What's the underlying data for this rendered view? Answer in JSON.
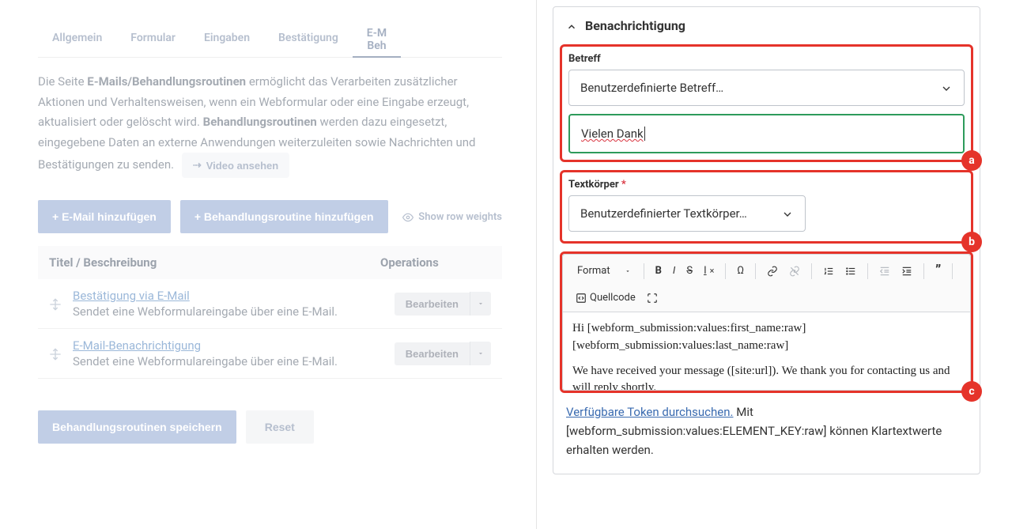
{
  "tabs": [
    "Allgemein",
    "Formular",
    "Eingaben",
    "Bestätigung",
    "E-M\nBeh"
  ],
  "intro": {
    "pre": "Die Seite ",
    "strong1": "E-Mails/Behandlungsroutinen",
    "mid": " ermöglicht das Verarbeiten zusätzlicher Aktionen und Verhaltensweisen, wenn ein Webformular oder eine Eingabe erzeugt, aktualisiert oder gelöscht wird. ",
    "strong2": "Behandlungsroutinen",
    "post": " werden dazu eingesetzt, eingegebene Daten an externe Anwendungen weiterzuleiten sowie Nachrichten und Bestätigungen zu senden. ",
    "video": "Video ansehen"
  },
  "buttons": {
    "addEmail": "+ E-Mail hinzufügen",
    "addHandler": "+ Behandlungsroutine hinzufügen",
    "showWeights": "Show row weights",
    "edit": "Bearbeiten",
    "save": "Behandlungsroutinen speichern",
    "reset": "Reset"
  },
  "table": {
    "colTitle": "Titel / Beschreibung",
    "colOps": "Operations",
    "rows": [
      {
        "title": "Bestätigung via E-Mail",
        "desc": "Sendet eine Webformulareingabe über eine E-Mail."
      },
      {
        "title": "E-Mail-Benachrichtigung",
        "desc": "Sendet eine Webformulareingabe über eine E-Mail."
      }
    ]
  },
  "right": {
    "cardTitle": "Benachrichtigung",
    "subject": {
      "label": "Betreff",
      "select": "Benutzerdefinierte Betreff…",
      "value": "Vielen Dank"
    },
    "body": {
      "label": "Textkörper",
      "select": "Benutzerdefinierter Textkörper…",
      "formatLabel": "Format",
      "sourceLabel": "Quellcode",
      "p1": "Hi [webform_submission:values:first_name:raw] [webform_submission:values:last_name:raw]",
      "p2": "We have received your message ([site:url]). We thank you for contacting us and will reply shortly."
    },
    "tokenHelp": {
      "link": "Verfügbare Token durchsuchen.",
      "text": " Mit [webform_submission:values:ELEMENT_KEY:raw] können Klartextwerte erhalten werden."
    },
    "badges": {
      "a": "a",
      "b": "b",
      "c": "c"
    }
  }
}
